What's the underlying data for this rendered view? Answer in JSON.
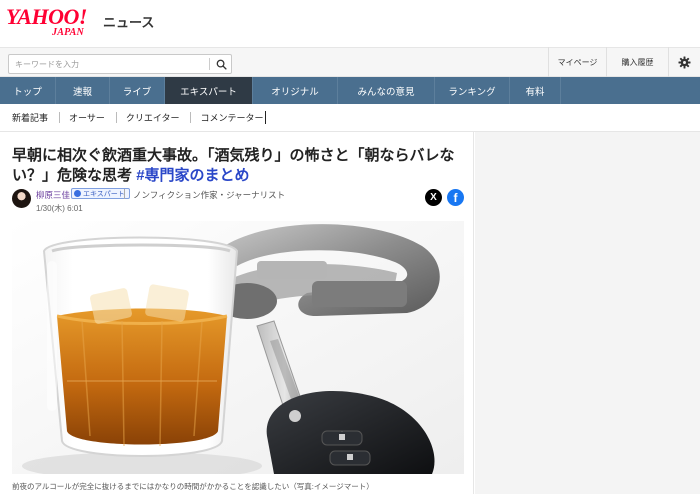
{
  "header": {
    "logo_main": "YAHOO!",
    "logo_sub": "JAPAN",
    "section": "ニュース"
  },
  "search": {
    "placeholder": "キーワードを入力",
    "icon": "search-icon"
  },
  "utility": {
    "mypage": "マイページ",
    "history": "購入履歴",
    "settings_icon": "gear-icon"
  },
  "nav": {
    "items": [
      {
        "label": "トップ"
      },
      {
        "label": "速報"
      },
      {
        "label": "ライブ"
      },
      {
        "label": "エキスパート"
      },
      {
        "label": "オリジナル"
      },
      {
        "label": "みんなの意見"
      },
      {
        "label": "ランキング"
      },
      {
        "label": "有料"
      }
    ],
    "active_index": 3
  },
  "subnav": {
    "items": [
      {
        "label": "新着記事"
      },
      {
        "label": "オーサー"
      },
      {
        "label": "クリエイター"
      },
      {
        "label": "コメンテーター"
      }
    ]
  },
  "article": {
    "title_line1": "早朝に相次ぐ飲酒重大事故。「酒気残り」の怖さと「朝ならバレな",
    "title_line2": "い？」危険な思考",
    "title_tag": "#専門家のまとめ",
    "author": {
      "name": "柳原三佳",
      "badge": "エキスパート",
      "role": "ノンフィクション作家・ジャーナリスト"
    },
    "date": "1/30(木) 6:01",
    "share": {
      "x_icon": "x-logo-icon",
      "x_glyph": "X",
      "facebook_icon": "facebook-icon",
      "facebook_glyph": "f"
    },
    "photo_caption": "前夜のアルコールが完全に抜けるまでにはかなりの時間がかかることを認識したい（写真:イメージマート）"
  },
  "colors": {
    "brand": "#ff0033",
    "nav_bg": "#4a6f8f",
    "nav_active": "#2f3a45",
    "tag": "#2a47c8",
    "author": "#6a3e9e"
  }
}
